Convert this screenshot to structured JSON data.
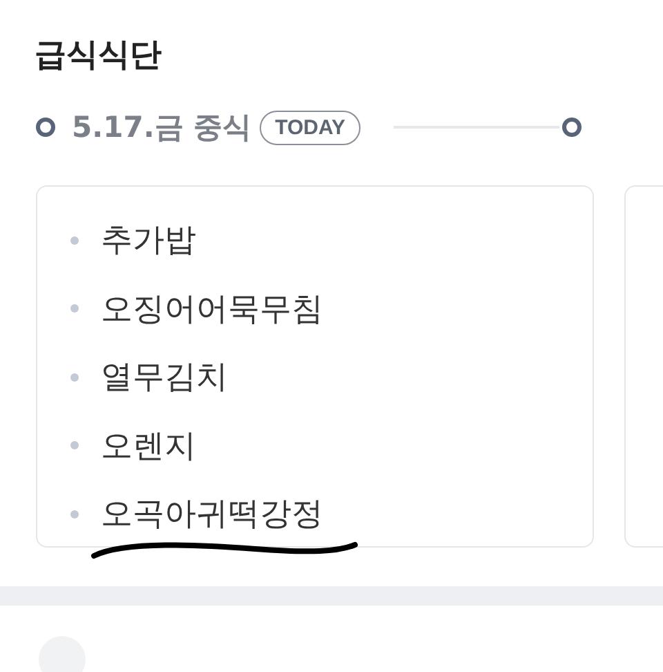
{
  "title": "급식식단",
  "meal": {
    "date": "5.17.금 중식",
    "badge": "TODAY"
  },
  "menu": [
    {
      "name": "추가밥",
      "underlined": false
    },
    {
      "name": "오징어어묵무침",
      "underlined": false
    },
    {
      "name": "열무김치",
      "underlined": false
    },
    {
      "name": "오렌지",
      "underlined": false
    },
    {
      "name": "오곡아귀떡강정",
      "underlined": true
    }
  ]
}
